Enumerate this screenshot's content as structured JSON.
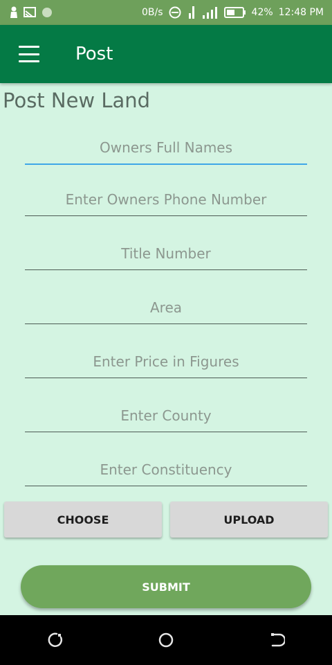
{
  "status_bar": {
    "net_speed": "0B/s",
    "battery": "42%",
    "time": "12:48 PM"
  },
  "app_bar": {
    "title": "Post",
    "menu_icon": "hamburger-menu-icon"
  },
  "page": {
    "title": "Post New Land"
  },
  "form": {
    "fields": [
      {
        "placeholder": "Owners Full Names",
        "value": ""
      },
      {
        "placeholder": "Enter Owners Phone Number",
        "value": ""
      },
      {
        "placeholder": "Title Number",
        "value": ""
      },
      {
        "placeholder": "Area",
        "value": ""
      },
      {
        "placeholder": "Enter Price in Figures",
        "value": ""
      },
      {
        "placeholder": "Enter County",
        "value": ""
      },
      {
        "placeholder": "Enter Constituency",
        "value": ""
      }
    ],
    "choose_label": "CHOOSE",
    "upload_label": "UPLOAD",
    "submit_label": "SUBMIT"
  },
  "colors": {
    "status_bar": "#6ea05b",
    "app_bar": "#047a45",
    "background": "#d4f4e2",
    "focus_underline": "#3fa6e8",
    "submit": "#70a75c"
  }
}
